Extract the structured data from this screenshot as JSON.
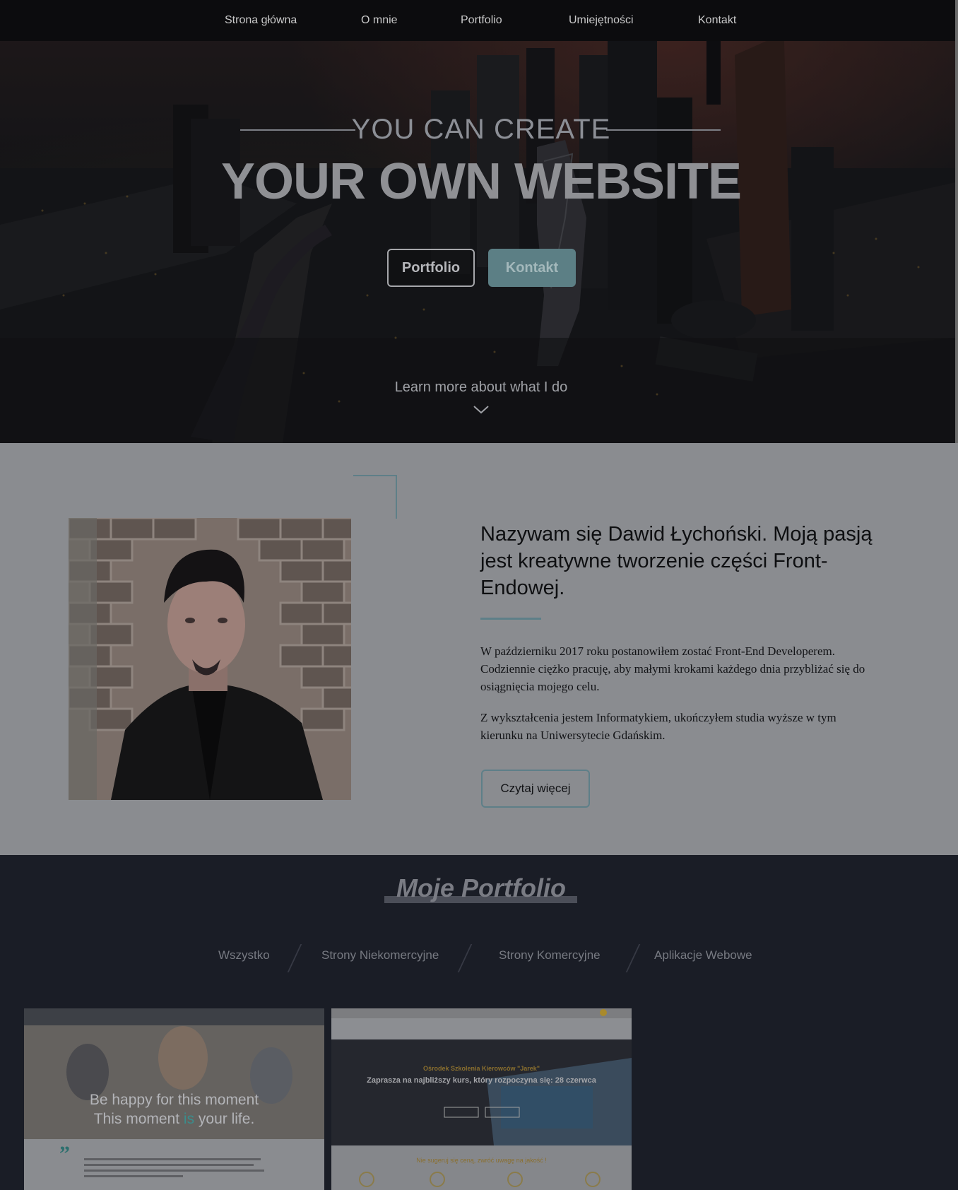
{
  "nav": {
    "items": [
      "Strona główna",
      "O mnie",
      "Portfolio",
      "Umiejętności",
      "Kontakt"
    ]
  },
  "hero": {
    "subtitle": "YOU CAN CREATE",
    "title": "YOUR OWN WEBSITE",
    "btn_portfolio": "Portfolio",
    "btn_contact": "Kontakt",
    "learn_more": "Learn more about what I do"
  },
  "about": {
    "title": "Nazywam się Dawid Łychoński. Moją pasją jest kreatywne tworzenie części Front-Endowej.",
    "paragraph1": "W październiku 2017 roku postanowiłem zostać Front-End Developerem. Codziennie ciężko pracuję, aby małymi krokami każdego dnia przybliżać się do osiągnięcia mojego celu.",
    "paragraph2": "Z wykształcenia jestem Informatykiem, ukończyłem studia wyższe w tym kierunku na Uniwersytecie Gdańskim.",
    "read_more": "Czytaj więcej"
  },
  "portfolio": {
    "title": "Moje Portfolio",
    "filters": [
      "Wszystko",
      "Strony Niekomercyjne",
      "Strony Komercyjne",
      "Aplikacje Webowe"
    ],
    "card1": {
      "line1": "Be happy for this moment",
      "line2a": "This moment ",
      "line2b": "is",
      "line2c": " your life."
    },
    "card2": {
      "heading": "Ośrodek Szkolenia Kierowców \"Jarek\"",
      "subheading": "Zaprasza na najbliższy kurs, który rozpoczyna się: 28 czerwca",
      "bottom": "Nie sugeruj się ceną, zwróć uwagę na jakość !"
    }
  },
  "colors": {
    "accent": "#5e7f88",
    "nav_bg": "#0c0c0e",
    "portfolio_bg": "#1a1d26"
  }
}
